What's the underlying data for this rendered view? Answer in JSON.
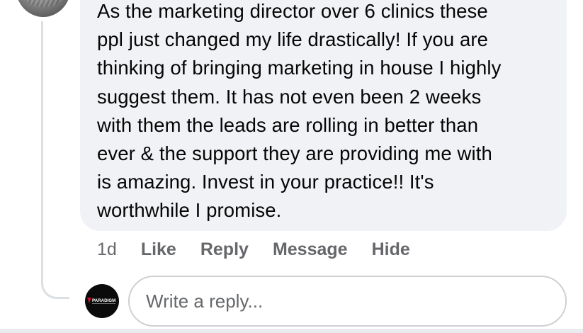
{
  "comment": {
    "lines": [
      "As the marketing director over 6 clinics these",
      "ppl just changed my life drastically! If you are",
      "thinking of bringing marketing in house I highly",
      "suggest them. It has not even been 2 weeks",
      "with them the leads are rolling in better than",
      "ever & the support they are providing me with",
      "is amazing. Invest in your practice!! It's",
      "worthwhile I promise."
    ],
    "time_ago": "1d",
    "actions": {
      "like": "Like",
      "reply": "Reply",
      "message": "Message",
      "hide": "Hide"
    }
  },
  "reply_box": {
    "placeholder": "Write a reply...",
    "avatar_logo_text": "PARADIGM"
  },
  "colors": {
    "bubble_bg": "#f0f2f5",
    "text": "#050505",
    "muted": "#65676b",
    "border": "#ced0d4",
    "logo_red": "#c8102e"
  }
}
